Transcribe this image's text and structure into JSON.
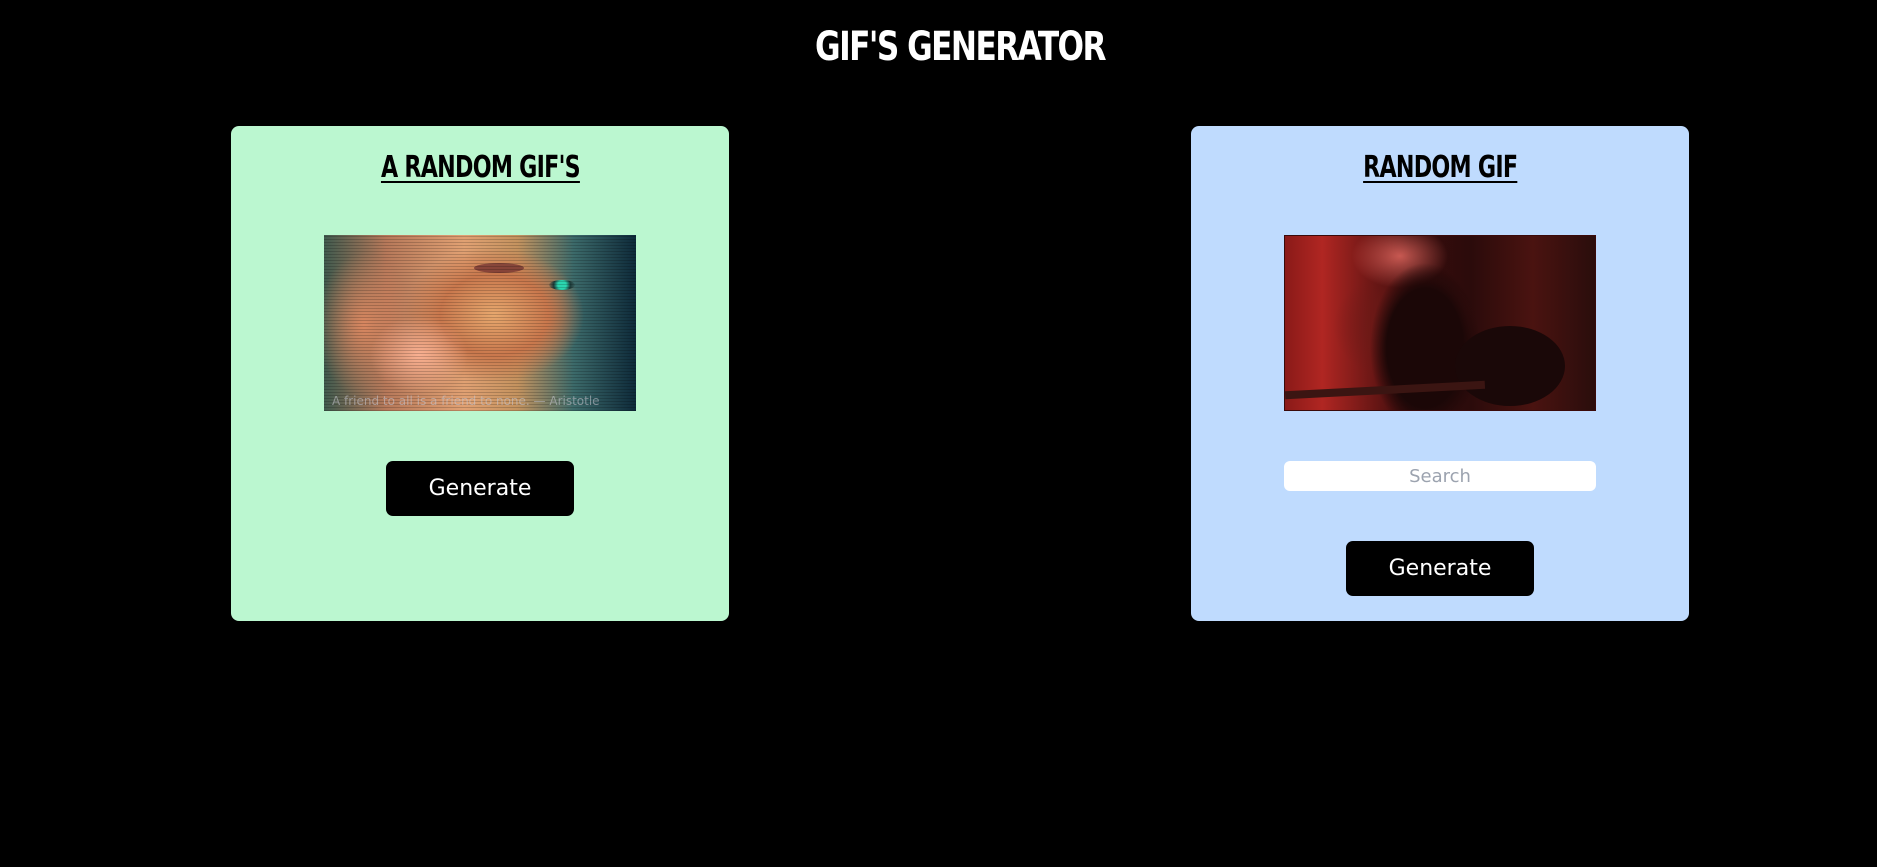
{
  "page": {
    "title": "GIF'S GENERATOR"
  },
  "random_card": {
    "heading": "A RANDOM GIF'S",
    "gif_caption": "A friend to all is a friend to none. — Aristotle",
    "generate_label": "Generate",
    "background_color": "#bbf7d0"
  },
  "tag_card": {
    "heading": "RANDOM GIF",
    "search": {
      "placeholder": "Search",
      "value": ""
    },
    "generate_label": "Generate",
    "background_color": "#bfdbfe"
  },
  "colors": {
    "page_background": "#000000",
    "button_background": "#000000",
    "button_text": "#ffffff"
  }
}
